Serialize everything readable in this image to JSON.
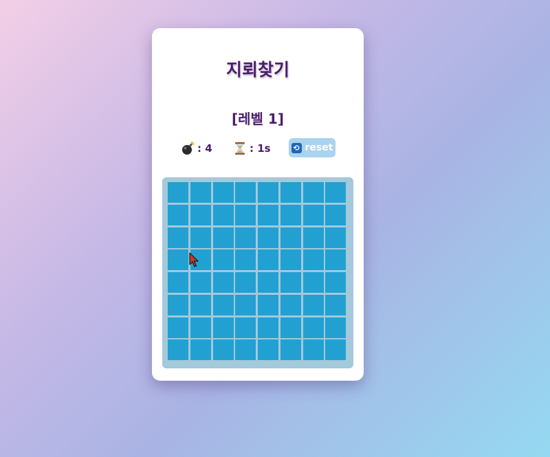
{
  "game": {
    "title": "지뢰찾기",
    "level_label": "[레벨 1]",
    "mines_text": ": 4",
    "timer_text": ": 1s",
    "reset_label": "reset",
    "rows": 8,
    "cols": 8,
    "cell_state": "covered",
    "colors": {
      "title": "#4b1d6b",
      "cell": "#22a0d2",
      "board_frame": "#a3c9da",
      "reset_bg": "#a9d3ee",
      "reset_icon_bg": "#1f66b8"
    },
    "icons": {
      "mines": "bomb-icon",
      "timer": "hourglass-icon",
      "reset": "repeat-icon"
    }
  }
}
